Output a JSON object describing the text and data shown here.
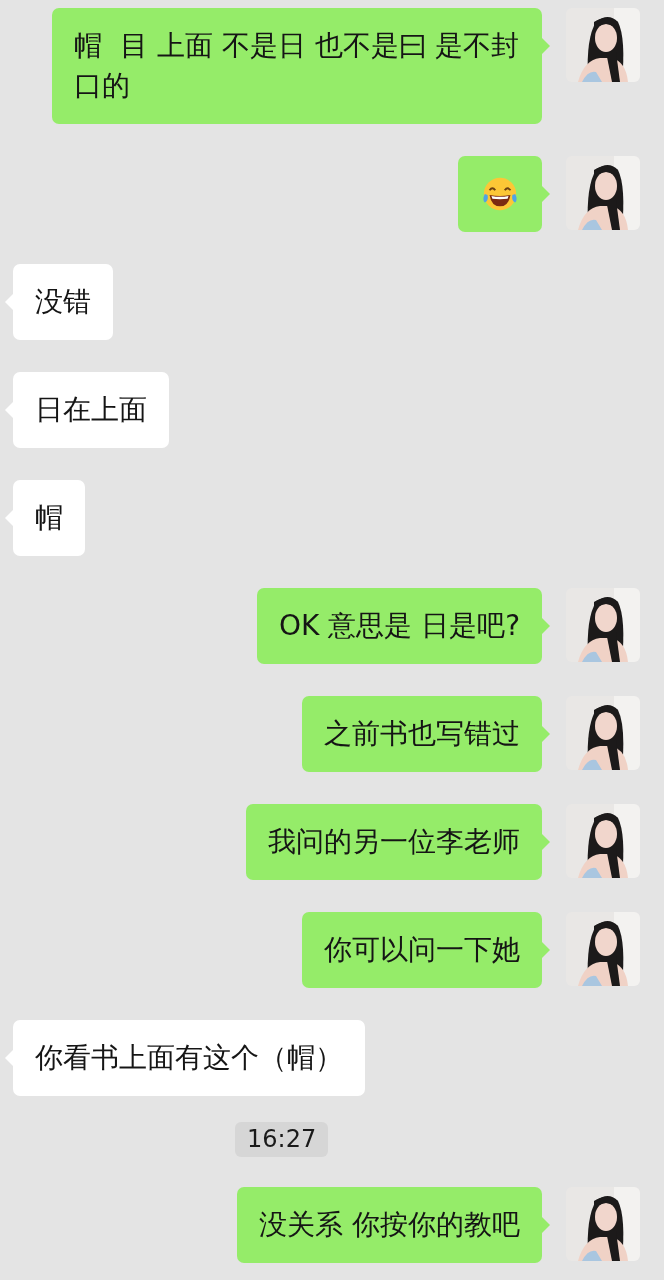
{
  "messages": [
    {
      "kind": "sent",
      "text": "帽  目 上面 不是日 也不是曰 是不封口的"
    },
    {
      "kind": "sent_emoji"
    },
    {
      "kind": "received",
      "text": "没错"
    },
    {
      "kind": "received",
      "text": "日在上面"
    },
    {
      "kind": "received",
      "text": "帽"
    },
    {
      "kind": "sent",
      "text": "OK 意思是 日是吧?"
    },
    {
      "kind": "sent",
      "text": "之前书也写错过"
    },
    {
      "kind": "sent",
      "text": "我问的另一位李老师"
    },
    {
      "kind": "sent",
      "text": "你可以问一下她"
    },
    {
      "kind": "received",
      "text": "你看书上面有这个（帽）"
    },
    {
      "kind": "time",
      "text": "16:27"
    },
    {
      "kind": "sent",
      "text": "没关系 你按你的教吧"
    }
  ]
}
